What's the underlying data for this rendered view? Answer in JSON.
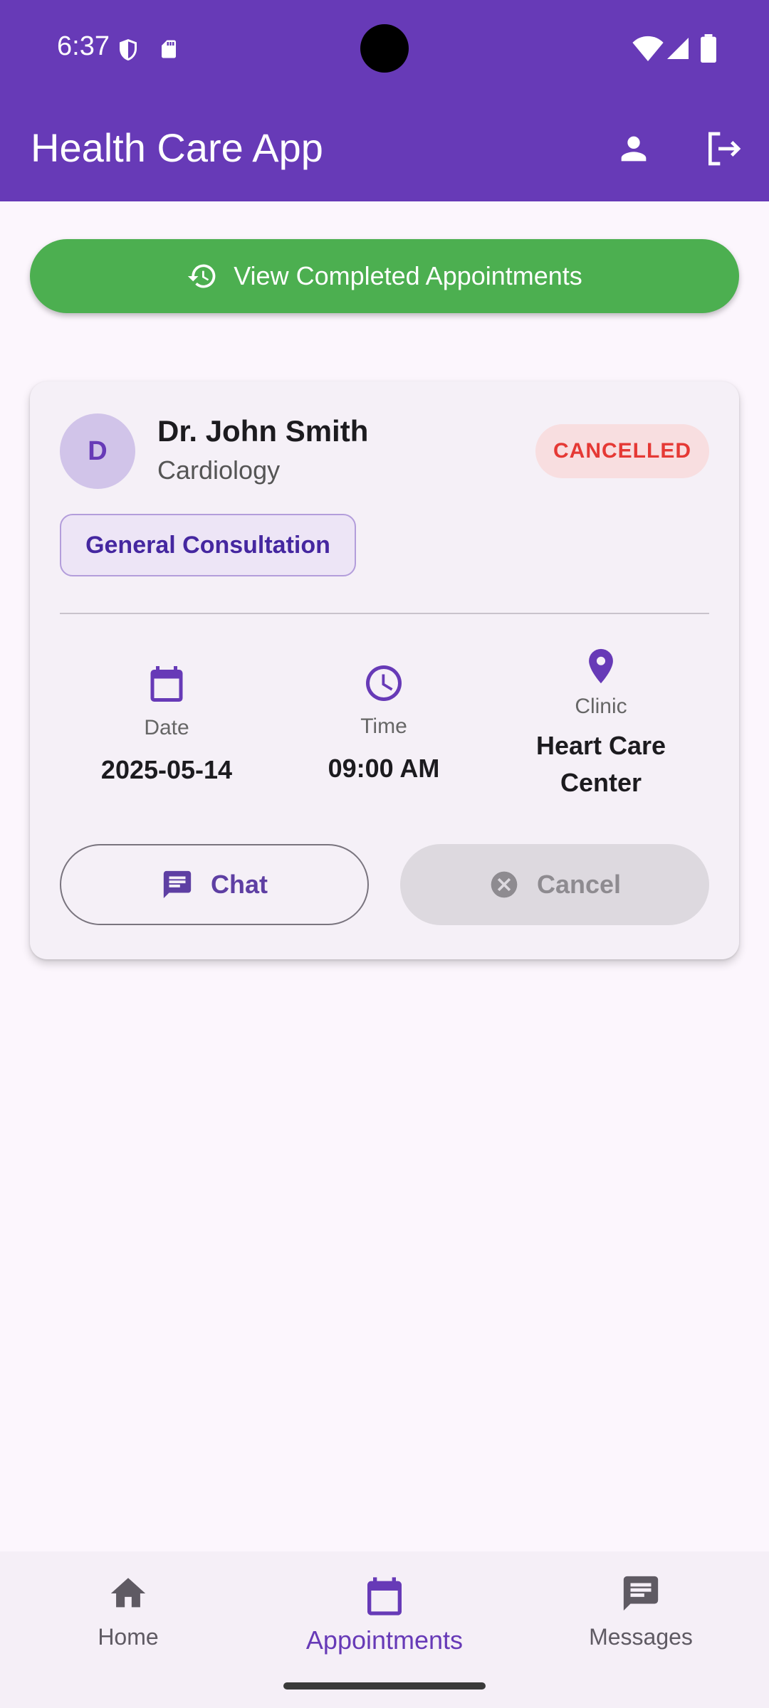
{
  "status_bar": {
    "time": "6:37"
  },
  "app_bar": {
    "title": "Health Care App",
    "profile_icon": "person-icon",
    "logout_icon": "logout-icon"
  },
  "completed_button": {
    "label": "View Completed Appointments",
    "icon": "history-icon"
  },
  "appointment": {
    "avatar_initial": "D",
    "doctor_name": "Dr. John Smith",
    "specialty": "Cardiology",
    "status": "CANCELLED",
    "type": "General Consultation",
    "date_label": "Date",
    "date_value": "2025-05-14",
    "time_label": "Time",
    "time_value": "09:00 AM",
    "clinic_label": "Clinic",
    "clinic_value_line1": "Heart Care",
    "clinic_value_line2": "Center",
    "chat_label": "Chat",
    "cancel_label": "Cancel"
  },
  "bottom_nav": {
    "items": [
      {
        "label": "Home",
        "icon": "home-icon"
      },
      {
        "label": "Appointments",
        "icon": "calendar-icon"
      },
      {
        "label": "Messages",
        "icon": "messages-icon"
      }
    ],
    "active_index": 1
  },
  "colors": {
    "primary": "#673AB7",
    "success": "#4CAF50",
    "cancelled": "#E53935"
  }
}
